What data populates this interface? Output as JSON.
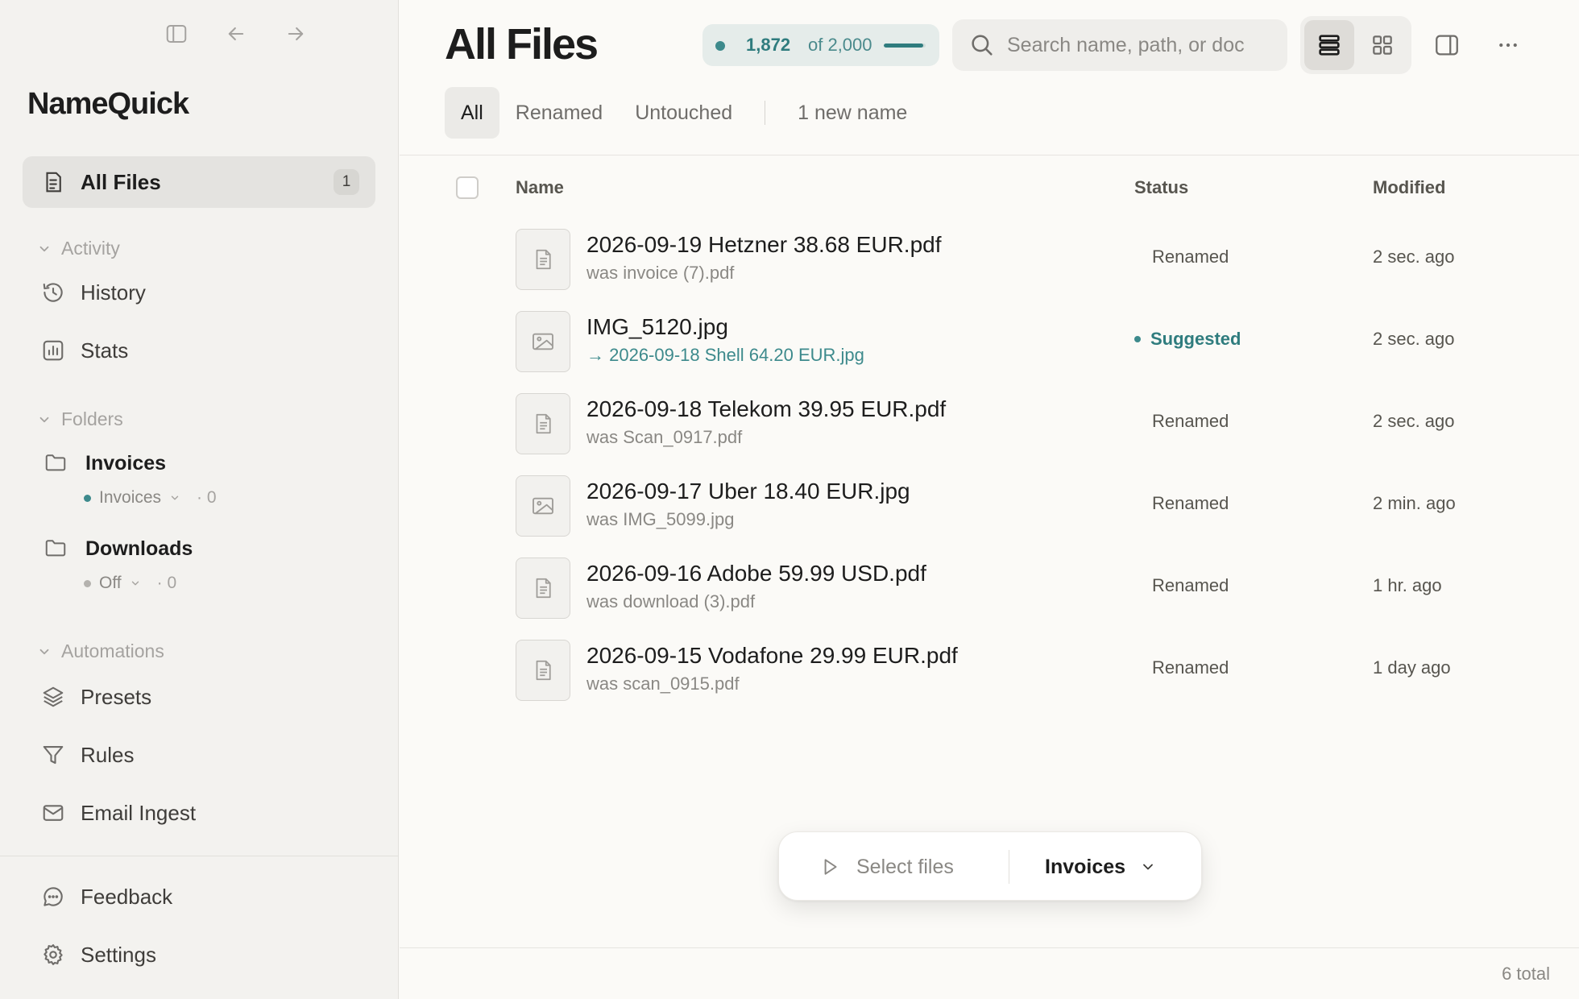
{
  "app": {
    "name": "NameQuick"
  },
  "sidebar": {
    "all_files": {
      "label": "All Files",
      "badge": "1"
    },
    "activity": {
      "header": "Activity",
      "items": [
        {
          "label": "History"
        },
        {
          "label": "Stats"
        }
      ]
    },
    "folders": {
      "header": "Folders",
      "items": [
        {
          "name": "Invoices",
          "preset": "Invoices",
          "count": "· 0",
          "status_color": "#3d8a8c"
        },
        {
          "name": "Downloads",
          "preset": "Off",
          "count": "· 0",
          "status_color": "#b4b2ae"
        }
      ]
    },
    "automations": {
      "header": "Automations",
      "items": [
        {
          "label": "Presets"
        },
        {
          "label": "Rules"
        },
        {
          "label": "Email Ingest"
        }
      ]
    },
    "footer": {
      "feedback": "Feedback",
      "settings": "Settings"
    }
  },
  "main": {
    "title": "All Files",
    "quota": {
      "used": "1,872",
      "total": "of 2,000",
      "fraction": 0.936
    },
    "search": {
      "placeholder": "Search name, path, or doc",
      "value": ""
    },
    "tabs": [
      {
        "label": "All"
      },
      {
        "label": "Renamed"
      },
      {
        "label": "Untouched"
      }
    ],
    "new_names": "1 new name",
    "columns": {
      "name": "Name",
      "status": "Status",
      "modified": "Modified"
    },
    "files": [
      {
        "name": "2026-09-19 Hetzner 38.68 EUR.pdf",
        "sub": "was invoice (7).pdf",
        "status": "Renamed",
        "modified": "2 sec. ago",
        "type": "doc"
      },
      {
        "name": "IMG_5120.jpg",
        "sub": "→ 2026-09-18 Shell 64.20 EUR.jpg",
        "status": "Suggested",
        "modified": "2 sec. ago",
        "type": "image"
      },
      {
        "name": "2026-09-18 Telekom 39.95 EUR.pdf",
        "sub": "was Scan_0917.pdf",
        "status": "Renamed",
        "modified": "2 sec. ago",
        "type": "doc"
      },
      {
        "name": "2026-09-17 Uber 18.40 EUR.jpg",
        "sub": "was IMG_5099.jpg",
        "status": "Renamed",
        "modified": "2 min. ago",
        "type": "image"
      },
      {
        "name": "2026-09-16 Adobe 59.99 USD.pdf",
        "sub": "was download (3).pdf",
        "status": "Renamed",
        "modified": "1 hr. ago",
        "type": "doc"
      },
      {
        "name": "2026-09-15 Vodafone 29.99 EUR.pdf",
        "sub": "was scan_0915.pdf",
        "status": "Renamed",
        "modified": "1 day ago",
        "type": "doc"
      }
    ],
    "action_bar": {
      "select_label": "Select files",
      "folder_label": "Invoices"
    },
    "footer_count": "6 total"
  },
  "colors": {
    "accent": "#2f7c7e",
    "background": "#fbfaf7",
    "sidebar": "#f3f2ef"
  }
}
